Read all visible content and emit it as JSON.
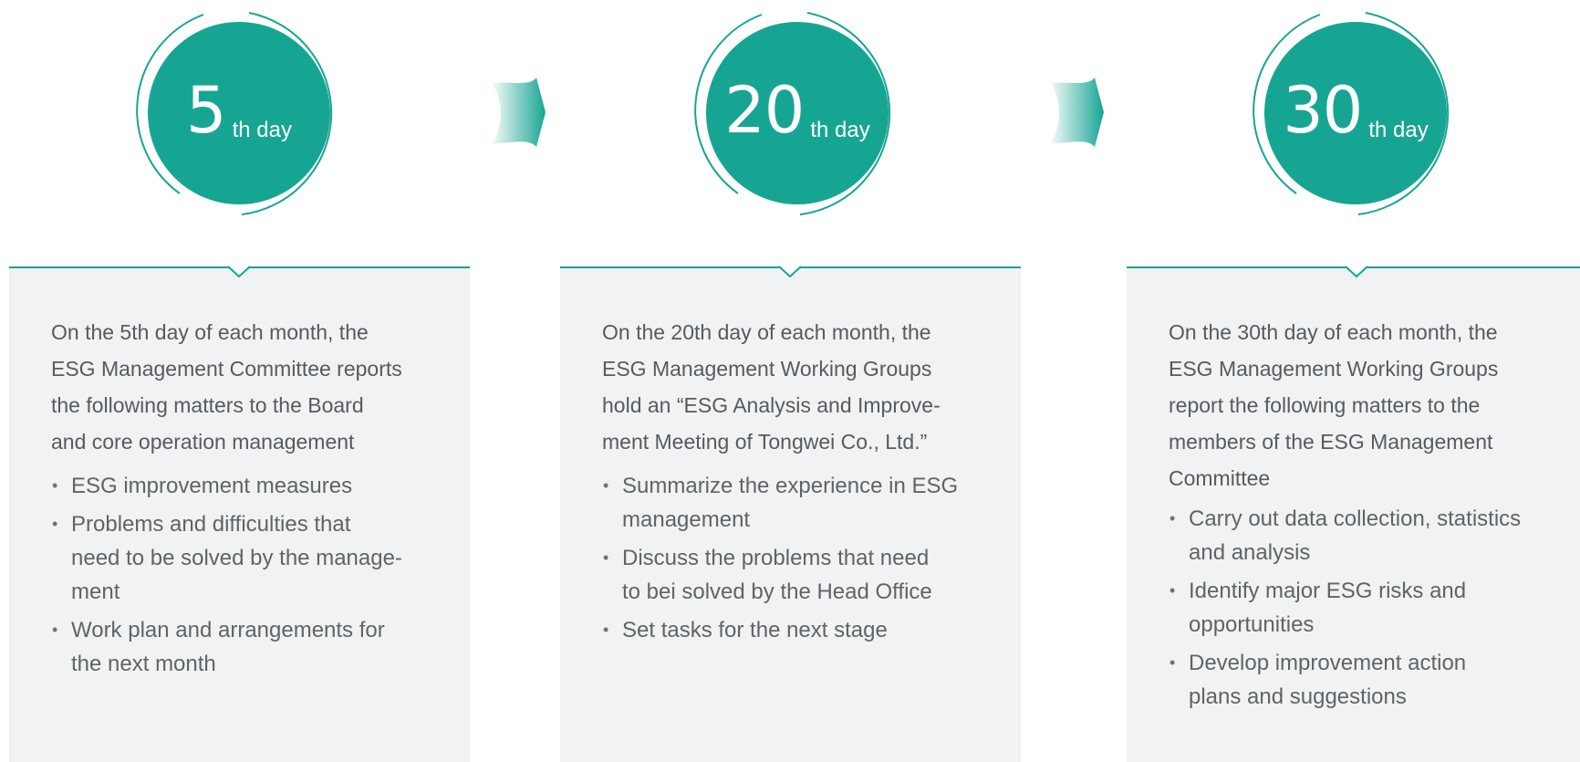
{
  "colors": {
    "accent": "#17a593",
    "card_background": "#f1f2f3",
    "text": "#555b60"
  },
  "steps": [
    {
      "number": "5",
      "suffix": "th day",
      "intro": "On the 5th day of each month, the\nESG Management Committee reports\nthe following matters to the Board\nand core operation management",
      "items": [
        "ESG improvement measures",
        "Problems and difficulties that\nneed to be solved by the manage-\nment",
        "Work plan and arrangements for\nthe next month"
      ]
    },
    {
      "number": "20",
      "suffix": "th day",
      "intro": "On the 20th day of each month, the\nESG Management Working Groups\nhold an “ESG Analysis and Improve-\nment Meeting of Tongwei Co., Ltd.”",
      "items": [
        "Summarize the experience in ESG\nmanagement",
        "Discuss the problems that need\nto bei solved by the Head Office",
        "Set tasks for the next stage"
      ]
    },
    {
      "number": "30",
      "suffix": "th day",
      "intro": "On the 30th day of each month, the\nESG Management Working Groups\nreport the following matters to the\nmembers of the ESG Management\nCommittee",
      "items": [
        "Carry out data collection, statistics\nand analysis",
        "Identify major ESG risks and\nopportunities",
        "Develop improvement action\nplans and suggestions"
      ]
    }
  ]
}
